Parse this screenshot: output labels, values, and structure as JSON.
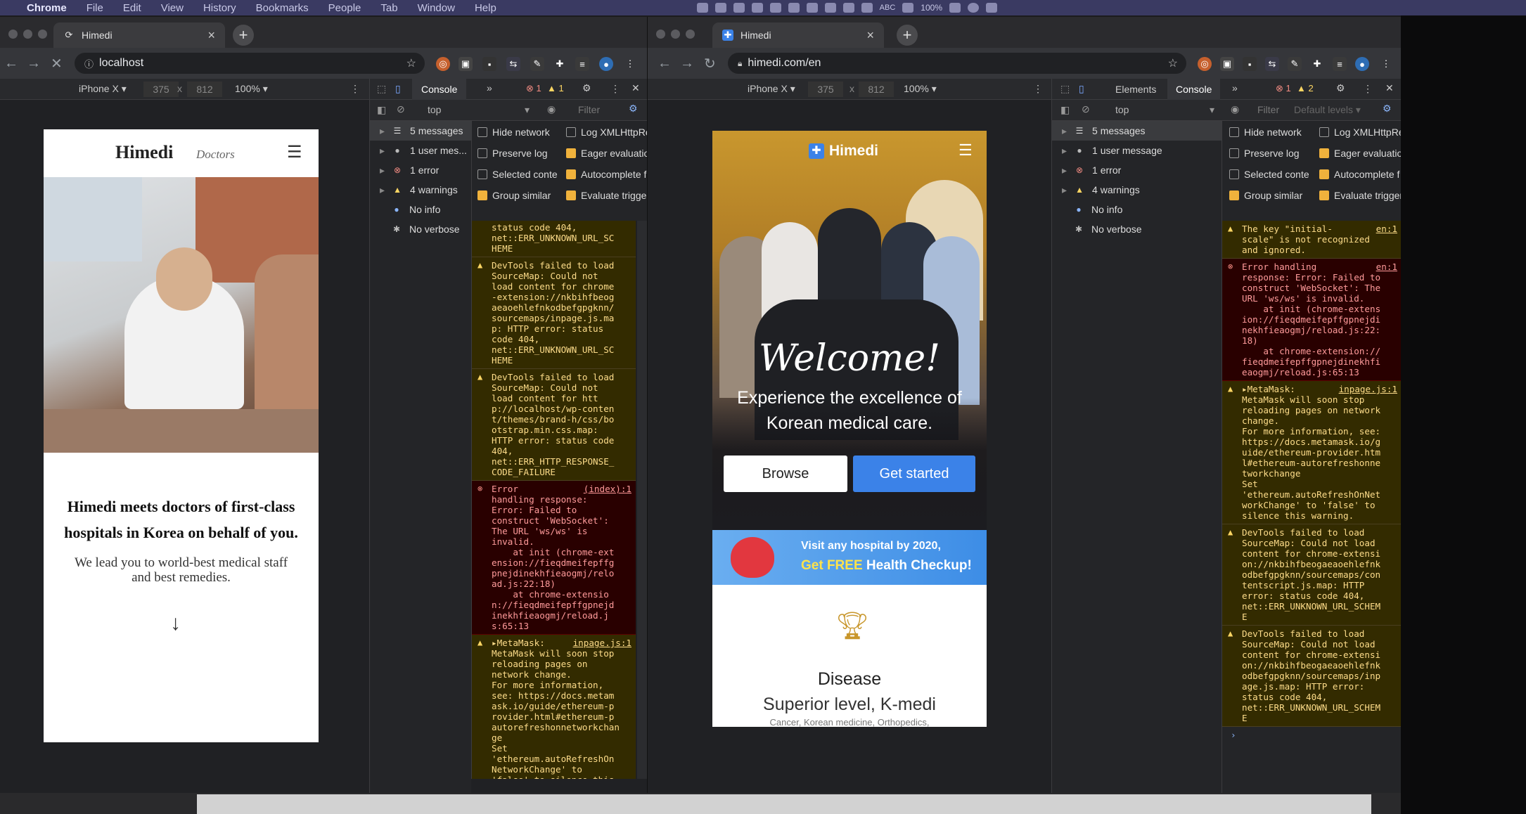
{
  "menubar": {
    "apple": "",
    "items": [
      "Chrome",
      "File",
      "Edit",
      "View",
      "History",
      "Bookmarks",
      "People",
      "Tab",
      "Window",
      "Help"
    ],
    "tray_text": [
      "100%",
      "ABC"
    ]
  },
  "left": {
    "tab_title": "Himedi",
    "url": "localhost",
    "device": "iPhone X ▾",
    "width": "375",
    "height": "812",
    "zoom": "100% ▾",
    "panel_tab": "Console",
    "errors": "1",
    "warnings": "1",
    "context": "top",
    "filter_placeholder": "Filter",
    "sidebar": [
      {
        "icon": "list",
        "label": "5 messages"
      },
      {
        "icon": "user",
        "label": "1 user mes..."
      },
      {
        "icon": "error",
        "label": "1 error"
      },
      {
        "icon": "warning",
        "label": "4 warnings"
      },
      {
        "icon": "info",
        "label": "No info"
      },
      {
        "icon": "verbose",
        "label": "No verbose"
      }
    ],
    "options": [
      {
        "label": "Hide network",
        "checked": false
      },
      {
        "label": "Log XMLHttpRe",
        "checked": false
      },
      {
        "label": "Preserve log",
        "checked": false
      },
      {
        "label": "Eager evaluatio",
        "checked": true
      },
      {
        "label": "Selected conte",
        "checked": false
      },
      {
        "label": "Autocomplete f",
        "checked": true
      },
      {
        "label": "Group similar",
        "checked": true
      },
      {
        "label": "Evaluate trigger",
        "checked": true
      }
    ],
    "log": [
      {
        "type": "warn",
        "src": "",
        "text": "status code 404,\nnet::ERR_UNKNOWN_URL_SC\nHEME"
      },
      {
        "type": "warn",
        "src": "",
        "text": "DevTools failed to load\nSourceMap: Could not\nload content for chrome\n-extension://nkbihfbeog\naeaoehlefnkodbefgpgknn/\nsourcemaps/inpage.js.ma\np: HTTP error: status\ncode 404,\nnet::ERR_UNKNOWN_URL_SC\nHEME"
      },
      {
        "type": "warn",
        "src": "",
        "text": "DevTools failed to load\nSourceMap: Could not\nload content for htt\np://localhost/wp-conten\nt/themes/brand-h/css/bo\notstrap.min.css.map:\nHTTP error: status code\n404,\nnet::ERR_HTTP_RESPONSE_\nCODE_FAILURE"
      },
      {
        "type": "err",
        "src": "(index):1",
        "text": "Error\nhandling response:\nError: Failed to\nconstruct 'WebSocket':\nThe URL 'ws/ws' is\ninvalid.\n    at init (chrome-ext\nension://fieqdmeifepffg\npnejdinekhfieaogmj/relo\nad.js:22:18)\n    at chrome-extensio\nn://fieqdmeifepffgpnejd\ninekhfieaogmj/reload.j\ns:65:13"
      },
      {
        "type": "warn",
        "src": "inpage.js:1",
        "text": "▸MetaMask:\nMetaMask will soon stop\nreloading pages on\nnetwork change.\nFor more information,\nsee: https://docs.metam\nask.io/guide/ethereum-p\nrovider.html#ethereum-p\nautorefreshonnetworkchan\nge\nSet\n'ethereum.autoRefreshOn\nNetworkChange' to\n'false' to silence this\nwarning."
      }
    ],
    "prompt": "›",
    "site": {
      "logo": "Himedi",
      "logo_tag": "Doctors",
      "headline": "Himedi meets doctors of first-class hospitals in Korea on behalf of you.",
      "sub": "We lead you to world-best medical staff and best remedies.",
      "arrow": "↓"
    }
  },
  "right": {
    "tab_title": "Himedi",
    "url": "himedi.com/en",
    "device": "iPhone X ▾",
    "width": "375",
    "height": "812",
    "zoom": "100% ▾",
    "panel_tabs": [
      "Elements",
      "Console"
    ],
    "errors": "1",
    "warnings": "2",
    "context": "top",
    "filter_placeholder": "Filter",
    "levels": "Default levels ▾",
    "sidebar": [
      {
        "icon": "list",
        "label": "5 messages"
      },
      {
        "icon": "user",
        "label": "1 user message"
      },
      {
        "icon": "error",
        "label": "1 error"
      },
      {
        "icon": "warning",
        "label": "4 warnings"
      },
      {
        "icon": "info",
        "label": "No info"
      },
      {
        "icon": "verbose",
        "label": "No verbose"
      }
    ],
    "options": [
      {
        "label": "Hide network",
        "checked": false
      },
      {
        "label": "Log XMLHttpRe",
        "checked": false
      },
      {
        "label": "Preserve log",
        "checked": false
      },
      {
        "label": "Eager evaluatio",
        "checked": true
      },
      {
        "label": "Selected conte",
        "checked": false
      },
      {
        "label": "Autocomplete f",
        "checked": true
      },
      {
        "label": "Group similar",
        "checked": true
      },
      {
        "label": "Evaluate trigger",
        "checked": true
      }
    ],
    "log": [
      {
        "type": "warn",
        "src": "en:1",
        "text": "The key \"initial-\nscale\" is not recognized\nand ignored."
      },
      {
        "type": "err",
        "src": "en:1",
        "text": "Error handling\nresponse: Error: Failed to\nconstruct 'WebSocket': The\nURL 'ws/ws' is invalid.\n    at init (chrome-extens\nion://fieqdmeifepffgpnejdi\nnekhfieaogmj/reload.js:22:\n18)\n    at chrome-extension://\nfieqdmeifepffgpnejdinekhfi\neaogmj/reload.js:65:13"
      },
      {
        "type": "warn",
        "src": "inpage.js:1",
        "text": "▸MetaMask:\nMetaMask will soon stop\nreloading pages on network\nchange.\nFor more information, see:\nhttps://docs.metamask.io/g\nuide/ethereum-provider.htm\nl#ethereum-autorefreshonne\ntworkchange\nSet\n'ethereum.autoRefreshOnNet\nworkChange' to 'false' to\nsilence this warning."
      },
      {
        "type": "warn",
        "src": "",
        "text": "DevTools failed to load\nSourceMap: Could not load\ncontent for chrome-extensi\non://nkbihfbeogaeaoehlefnk\nodbefgpgknn/sourcemaps/con\ntentscript.js.map: HTTP\nerror: status code 404,\nnet::ERR_UNKNOWN_URL_SCHEM\nE"
      },
      {
        "type": "warn",
        "src": "",
        "text": "DevTools failed to load\nSourceMap: Could not load\ncontent for chrome-extensi\non://nkbihfbeogaeaoehlefnk\nodbefgpgknn/sourcemaps/inp\nage.js.map: HTTP error:\nstatus code 404,\nnet::ERR_UNKNOWN_URL_SCHEM\nE"
      }
    ],
    "prompt": "›",
    "site": {
      "logo": "Himedi",
      "welcome": "Welcome!",
      "hero": "Experience the excellence of Korean medical care.",
      "browse": "Browse",
      "get_started": "Get started",
      "promo1": "Visit any hospital by 2020,",
      "promo_free": "Get FREE",
      "promo_rest": " Health Checkup!",
      "section_title": "Disease",
      "section_sub": "Superior level, K-medi",
      "section_small": "Cancer, Korean medicine, Orthopedics,"
    }
  },
  "colors": {
    "accent": "#3b82e8",
    "warn_bg": "#332b00",
    "err_bg": "#290000",
    "menubar": "#3a3a62"
  }
}
